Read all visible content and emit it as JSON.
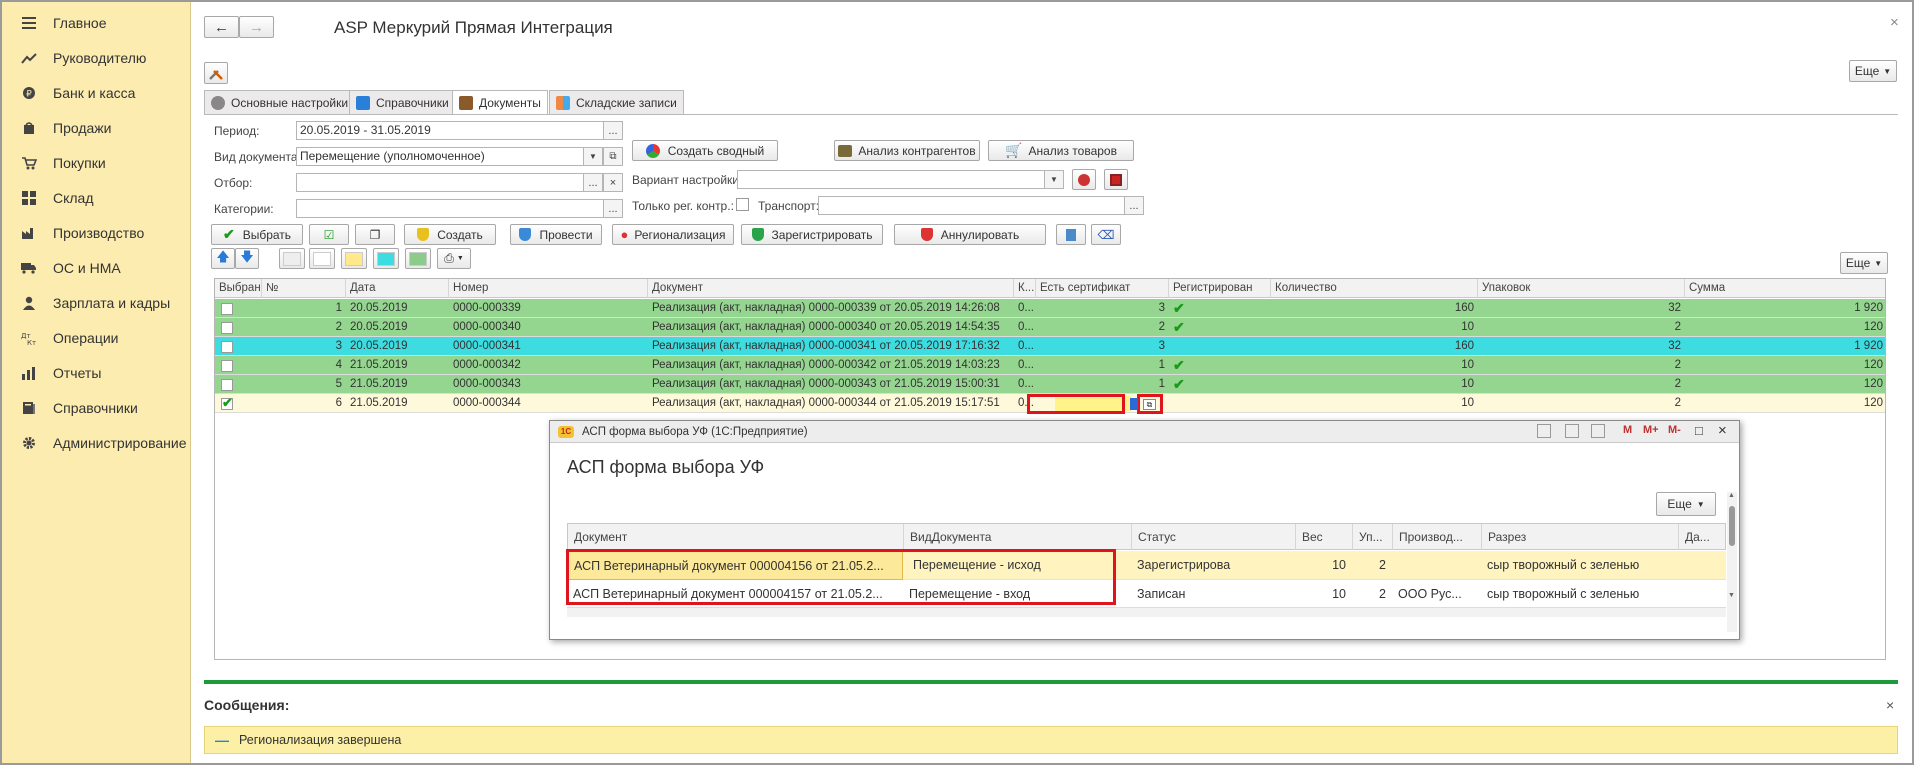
{
  "sidebar": {
    "items": [
      {
        "label": "Главное",
        "icon": "menu-icon"
      },
      {
        "label": "Руководителю",
        "icon": "trend-icon"
      },
      {
        "label": "Банк и касса",
        "icon": "coin-icon"
      },
      {
        "label": "Продажи",
        "icon": "bag-icon"
      },
      {
        "label": "Покупки",
        "icon": "cart-icon"
      },
      {
        "label": "Склад",
        "icon": "grid-icon"
      },
      {
        "label": "Производство",
        "icon": "factory-icon"
      },
      {
        "label": "ОС и НМА",
        "icon": "truck-icon"
      },
      {
        "label": "Зарплата и кадры",
        "icon": "person-icon"
      },
      {
        "label": "Операции",
        "icon": "dt-kt-icon"
      },
      {
        "label": "Отчеты",
        "icon": "chart-icon"
      },
      {
        "label": "Справочники",
        "icon": "book-icon"
      },
      {
        "label": "Администрирование",
        "icon": "gear-icon"
      }
    ]
  },
  "header": {
    "title": "ASP Меркурий Прямая Интеграция",
    "more_label": "Еще",
    "close_symbol": "×"
  },
  "tabs": [
    {
      "label": "Основные настройки"
    },
    {
      "label": "Справочники"
    },
    {
      "label": "Документы"
    },
    {
      "label": "Складские записи"
    }
  ],
  "filters": {
    "period_label": "Период:",
    "period_value": "20.05.2019 - 31.05.2019",
    "doc_type_label": "Вид документа:",
    "doc_type_value": "Перемещение (уполномоченное)",
    "filter_label": "Отбор:",
    "filter_value": "",
    "categories_label": "Категории:",
    "categories_value": "",
    "create_summary_label": "Создать сводный",
    "analyze_contractors_label": "Анализ контрагентов",
    "analyze_goods_label": "Анализ товаров",
    "variant_label": "Вариант настройки:",
    "variant_value": "",
    "only_reg_label": "Только рег. контр.:",
    "transport_label": "Транспорт:",
    "transport_value": ""
  },
  "actions": {
    "select": "Выбрать",
    "create": "Создать",
    "post": "Провести",
    "regionalize": "Регионализация",
    "register": "Зарегистрировать",
    "cancel": "Аннулировать",
    "more": "Еще"
  },
  "grid": {
    "columns": [
      "Выбран",
      "№",
      "Дата",
      "Номер",
      "Документ",
      "К...",
      "Есть сертификат",
      "Регистрирован",
      "Количество",
      "Упаковок",
      "Сумма"
    ],
    "rows": [
      {
        "n": "1",
        "date": "20.05.2019",
        "number": "0000-000339",
        "doc": "Реализация (акт, накладная) 0000-000339 от 20.05.2019 14:26:08",
        "k": "0...",
        "cert": "3",
        "reg": true,
        "qty": "160",
        "pack": "32",
        "sum": "1 920",
        "style": "green",
        "checked": false
      },
      {
        "n": "2",
        "date": "20.05.2019",
        "number": "0000-000340",
        "doc": "Реализация (акт, накладная) 0000-000340 от 20.05.2019 14:54:35",
        "k": "0...",
        "cert": "2",
        "reg": true,
        "qty": "10",
        "pack": "2",
        "sum": "120",
        "style": "green",
        "checked": false
      },
      {
        "n": "3",
        "date": "20.05.2019",
        "number": "0000-000341",
        "doc": "Реализация (акт, накладная) 0000-000341 от 20.05.2019 17:16:32",
        "k": "0...",
        "cert": "3",
        "reg": false,
        "qty": "160",
        "pack": "32",
        "sum": "1 920",
        "style": "cyan",
        "checked": false
      },
      {
        "n": "4",
        "date": "21.05.2019",
        "number": "0000-000342",
        "doc": "Реализация (акт, накладная) 0000-000342 от 21.05.2019 14:03:23",
        "k": "0...",
        "cert": "1",
        "reg": true,
        "qty": "10",
        "pack": "2",
        "sum": "120",
        "style": "green",
        "checked": false
      },
      {
        "n": "5",
        "date": "21.05.2019",
        "number": "0000-000343",
        "doc": "Реализация (акт, накладная) 0000-000343 от 21.05.2019 15:00:31",
        "k": "0...",
        "cert": "1",
        "reg": true,
        "qty": "10",
        "pack": "2",
        "sum": "120",
        "style": "green",
        "checked": false
      },
      {
        "n": "6",
        "date": "21.05.2019",
        "number": "0000-000344",
        "doc": "Реализация (акт, накладная) 0000-000344 от 21.05.2019 15:17:51",
        "k": "0...",
        "cert": "",
        "reg": false,
        "qty": "10",
        "pack": "2",
        "sum": "120",
        "style": "yellow",
        "checked": true
      }
    ]
  },
  "dialog": {
    "window_title": "АСП форма выбора УФ  (1С:Предприятие)",
    "heading": "АСП форма выбора УФ",
    "more_label": "Еще",
    "columns": [
      "Документ",
      "ВидДокумента",
      "Статус",
      "Вес",
      "Уп...",
      "Производ...",
      "Разрез",
      "Да..."
    ],
    "rows": [
      {
        "doc": "АСП Ветеринарный документ 000004156 от 21.05.2...",
        "kind": "Перемещение - исход",
        "status": "Зарегистрирова",
        "weight": "10",
        "pack": "2",
        "producer": "",
        "cut": "сыр творожный с зеленью",
        "date": ""
      },
      {
        "doc": "АСП Ветеринарный документ 000004157 от 21.05.2...",
        "kind": "Перемещение - вход",
        "status": "Записан",
        "weight": "10",
        "pack": "2",
        "producer": "ООО Рус...",
        "cut": "сыр творожный с зеленью",
        "date": ""
      }
    ],
    "toolbar": [
      "M",
      "M+",
      "M-"
    ]
  },
  "messages": {
    "title": "Сообщения:",
    "text": "Регионализация завершена"
  },
  "colors": {
    "sidebar_bg": "#fcecb0",
    "row_green": "#94d58f",
    "row_cyan": "#3cdce0",
    "row_yellow": "#fff9db",
    "highlight": "#e0141c",
    "message_bg": "#fcefa6"
  }
}
